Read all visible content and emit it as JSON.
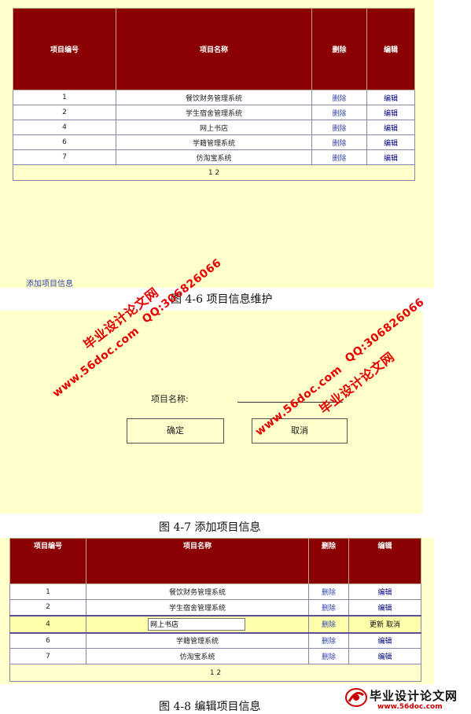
{
  "fig6": {
    "headers": [
      "项目编号",
      "项目名称",
      "删除",
      "编辑"
    ],
    "rows": [
      {
        "id": "1",
        "name": "餐饮财务管理系统",
        "del": "删除",
        "edit": "编辑"
      },
      {
        "id": "2",
        "name": "学生宿舍管理系统",
        "del": "删除",
        "edit": "编辑"
      },
      {
        "id": "4",
        "name": "网上书店",
        "del": "删除",
        "edit": "编辑"
      },
      {
        "id": "6",
        "name": "学籍管理系统",
        "del": "删除",
        "edit": "编辑"
      },
      {
        "id": "7",
        "name": "仿淘宝系统",
        "del": "删除",
        "edit": "编辑"
      }
    ],
    "pager": "1 2",
    "add_link": "添加项目信息",
    "caption": "图 4-6 项目信息维护"
  },
  "fig7": {
    "label": "项目名称:",
    "ok_button": "确定",
    "cancel_button": "取消",
    "caption": "图 4-7 添加项目信息"
  },
  "fig8": {
    "headers": [
      "项目编号",
      "项目名称",
      "删除",
      "编辑"
    ],
    "rows": [
      {
        "id": "1",
        "name": "餐饮财务管理系统",
        "del": "删除",
        "edit": "编辑"
      },
      {
        "id": "2",
        "name": "学生宿舍管理系统",
        "del": "删除",
        "edit": "编辑"
      }
    ],
    "edit_row": {
      "id": "4",
      "name_value": "网上书店",
      "del": "删除",
      "update": "更新",
      "cancel": "取消"
    },
    "rows_after": [
      {
        "id": "6",
        "name": "学籍管理系统",
        "del": "删除",
        "edit": "编辑"
      },
      {
        "id": "7",
        "name": "仿淘宝系统",
        "del": "删除",
        "edit": "编辑"
      }
    ],
    "pager": "1 2",
    "caption": "图 4-8 编辑项目信息"
  },
  "watermarks": {
    "site": "www.56doc.com",
    "qq": "QQ:306826066",
    "brand": "毕业设计论文网",
    "logo_text": "毕业设计论文网",
    "logo_url": "www.56doc.com"
  },
  "colors": {
    "header_bg": "#8b0000",
    "panel_bg": "#ffffcc",
    "watermark": "#e60000",
    "link": "#3344aa"
  }
}
